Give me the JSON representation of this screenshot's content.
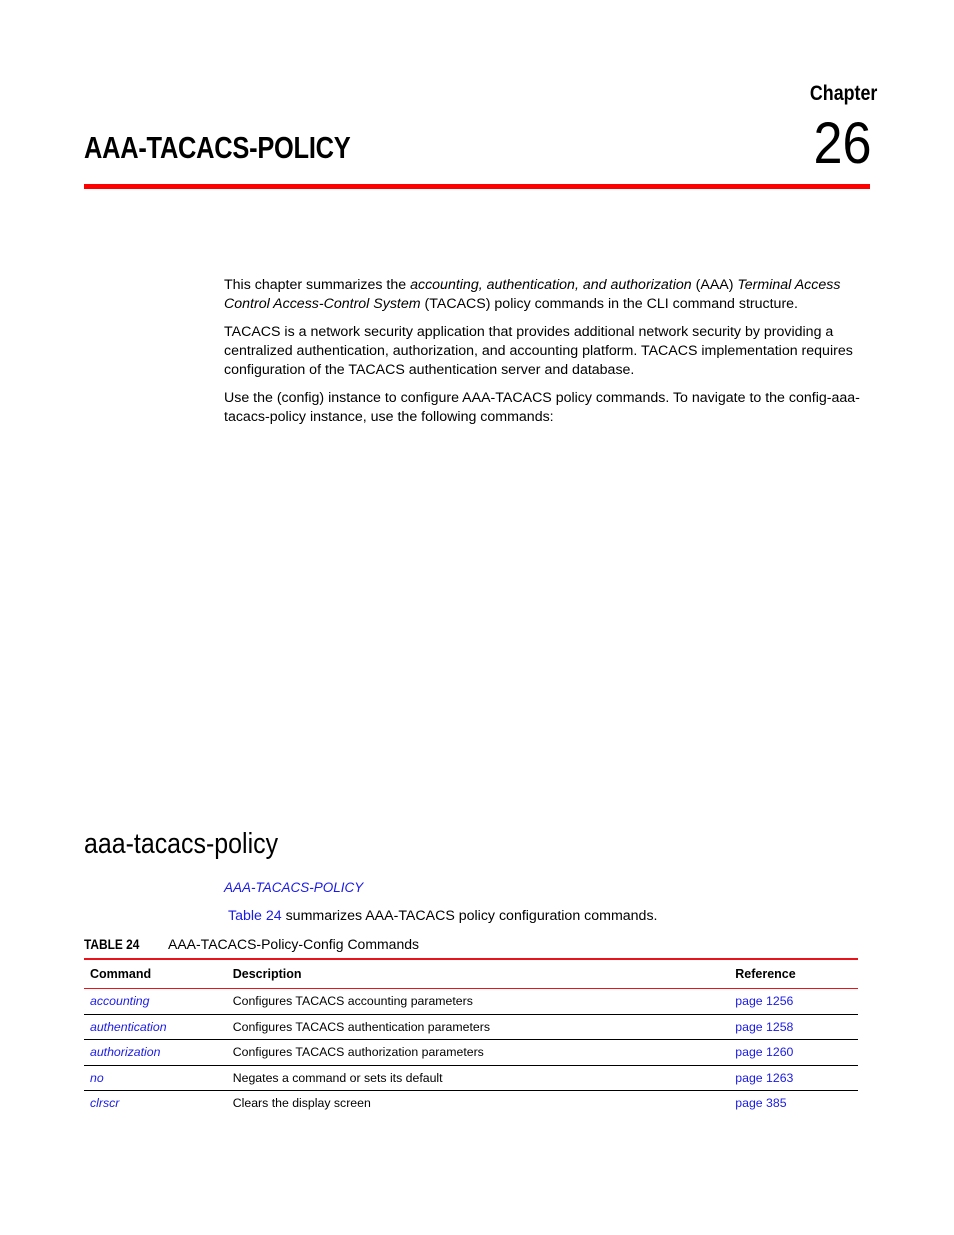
{
  "chapter": {
    "label": "Chapter",
    "number": "26",
    "title": "AAA-TACACS-POLICY",
    "rule_color": "#ff0000"
  },
  "intro": {
    "p1": {
      "t1": "This chapter summarizes the ",
      "i1": "accounting, authentication, and authorization",
      "t2": " (AAA) ",
      "i2": "Terminal Access Control Access-Control System",
      "t3": " (TACACS) policy commands in the CLI command structure."
    },
    "p2": "TACACS is a network security application that provides additional network security by providing a centralized authentication, authorization, and accounting platform. TACACS implementation requires configuration of the TACACS authentication server and database.",
    "p3": "Use the (config) instance to configure AAA-TACACS policy commands. To navigate to the config-aaa-tacacs-policy instance, use the following commands:"
  },
  "section": {
    "title": "aaa-tacacs-policy",
    "breadcrumb": "AAA-TACACS-POLICY",
    "summary_link": "Table 24",
    "summary_text": " summarizes AAA-TACACS policy configuration commands."
  },
  "table": {
    "tag": "TABLE 24",
    "caption": "AAA-TACACS-Policy-Config Commands",
    "headers": [
      "Command",
      "Description",
      "Reference"
    ],
    "rows": [
      {
        "command": "accounting",
        "description": "Configures TACACS accounting parameters",
        "reference": "page 1256"
      },
      {
        "command": "authentication",
        "description": "Configures TACACS authentication parameters",
        "reference": "page 1258"
      },
      {
        "command": "authorization",
        "description": "Configures TACACS authorization parameters",
        "reference": "page 1260"
      },
      {
        "command": "no",
        "description": "Negates a command or sets its default",
        "reference": "page 1263"
      },
      {
        "command": "clrscr",
        "description": "Clears the display screen",
        "reference": "page 385"
      }
    ]
  },
  "colors": {
    "link": "#1a1ae6",
    "accent_red": "#ff0000",
    "table_red": "#e8131b"
  }
}
